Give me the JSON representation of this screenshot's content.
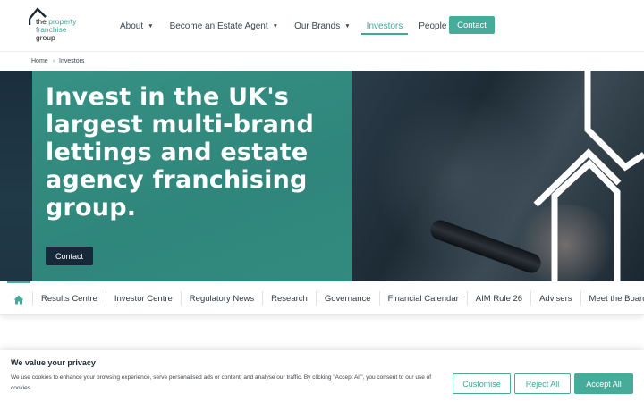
{
  "logo": {
    "line1_a": "the",
    "line1_b": "property",
    "line2": "franchise",
    "line3": "group"
  },
  "nav": {
    "items": [
      {
        "label": "About",
        "has_caret": true
      },
      {
        "label": "Become an Estate Agent",
        "has_caret": true
      },
      {
        "label": "Our Brands",
        "has_caret": true
      },
      {
        "label": "Investors",
        "has_caret": false,
        "active": true
      },
      {
        "label": "People",
        "has_caret": true
      }
    ],
    "contact_label": "Contact"
  },
  "breadcrumb": {
    "home": "Home",
    "current": "Investors"
  },
  "hero": {
    "title": "Invest in the UK's largest multi-brand lettings and estate agency franchising group.",
    "button_label": "Contact"
  },
  "subnav": {
    "home_icon": "home-icon",
    "items": [
      "Results Centre",
      "Investor Centre",
      "Regulatory News",
      "Research",
      "Governance",
      "Financial Calendar",
      "AIM Rule 26",
      "Advisers",
      "Meet the Board"
    ]
  },
  "cookie": {
    "title": "We value your privacy",
    "text": "We use cookies to enhance your browsing experience, serve personalised ads or content, and analyse our traffic. By clicking \"Accept All\", you consent to our use of cookies.",
    "customise": "Customise",
    "reject": "Reject All",
    "accept": "Accept All"
  },
  "colors": {
    "brand_teal": "#46ab98",
    "navy": "#17283a"
  }
}
